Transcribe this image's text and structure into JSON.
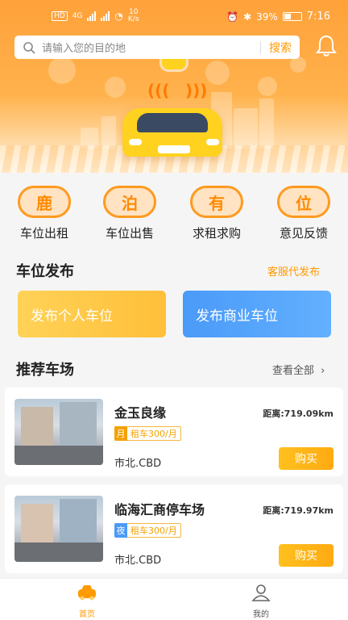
{
  "status": {
    "net_left": "HD",
    "net_mid": "4G",
    "speed": "10",
    "speed_unit": "K/s",
    "battery": "39%",
    "time": "7:16"
  },
  "search": {
    "placeholder": "请输入您的目的地",
    "button": "搜索"
  },
  "quick_menu": [
    {
      "icon_text": "鹿",
      "label": "车位出租"
    },
    {
      "icon_text": "泊",
      "label": "车位出售"
    },
    {
      "icon_text": "有",
      "label": "求租求购"
    },
    {
      "icon_text": "位",
      "label": "意见反馈"
    }
  ],
  "publish": {
    "title": "车位发布",
    "link": "客服代发布",
    "personal": "发布个人车位",
    "business": "发布商业车位"
  },
  "recommend": {
    "title": "推荐车场",
    "view_all": "查看全部",
    "lots": [
      {
        "name": "金玉良缘",
        "distance": "距离:719.09km",
        "tag_type": "月",
        "tag_price": "租车300/月",
        "area": "市北.CBD",
        "buy": "购买",
        "tag_color": "#f3a100"
      },
      {
        "name": "临海汇商停车场",
        "distance": "距离:719.97km",
        "tag_type": "夜",
        "tag_price": "租车300/月",
        "area": "市北.CBD",
        "buy": "购买",
        "tag_color": "#4a9af8"
      }
    ]
  },
  "tabs": [
    {
      "label": "首页",
      "icon": "car-icon",
      "active": true
    },
    {
      "label": "我的",
      "icon": "user-icon",
      "active": false
    }
  ],
  "colors": {
    "accent": "#ff9a00",
    "active_tab": "#ff9a00",
    "inactive_tab": "#555555"
  }
}
